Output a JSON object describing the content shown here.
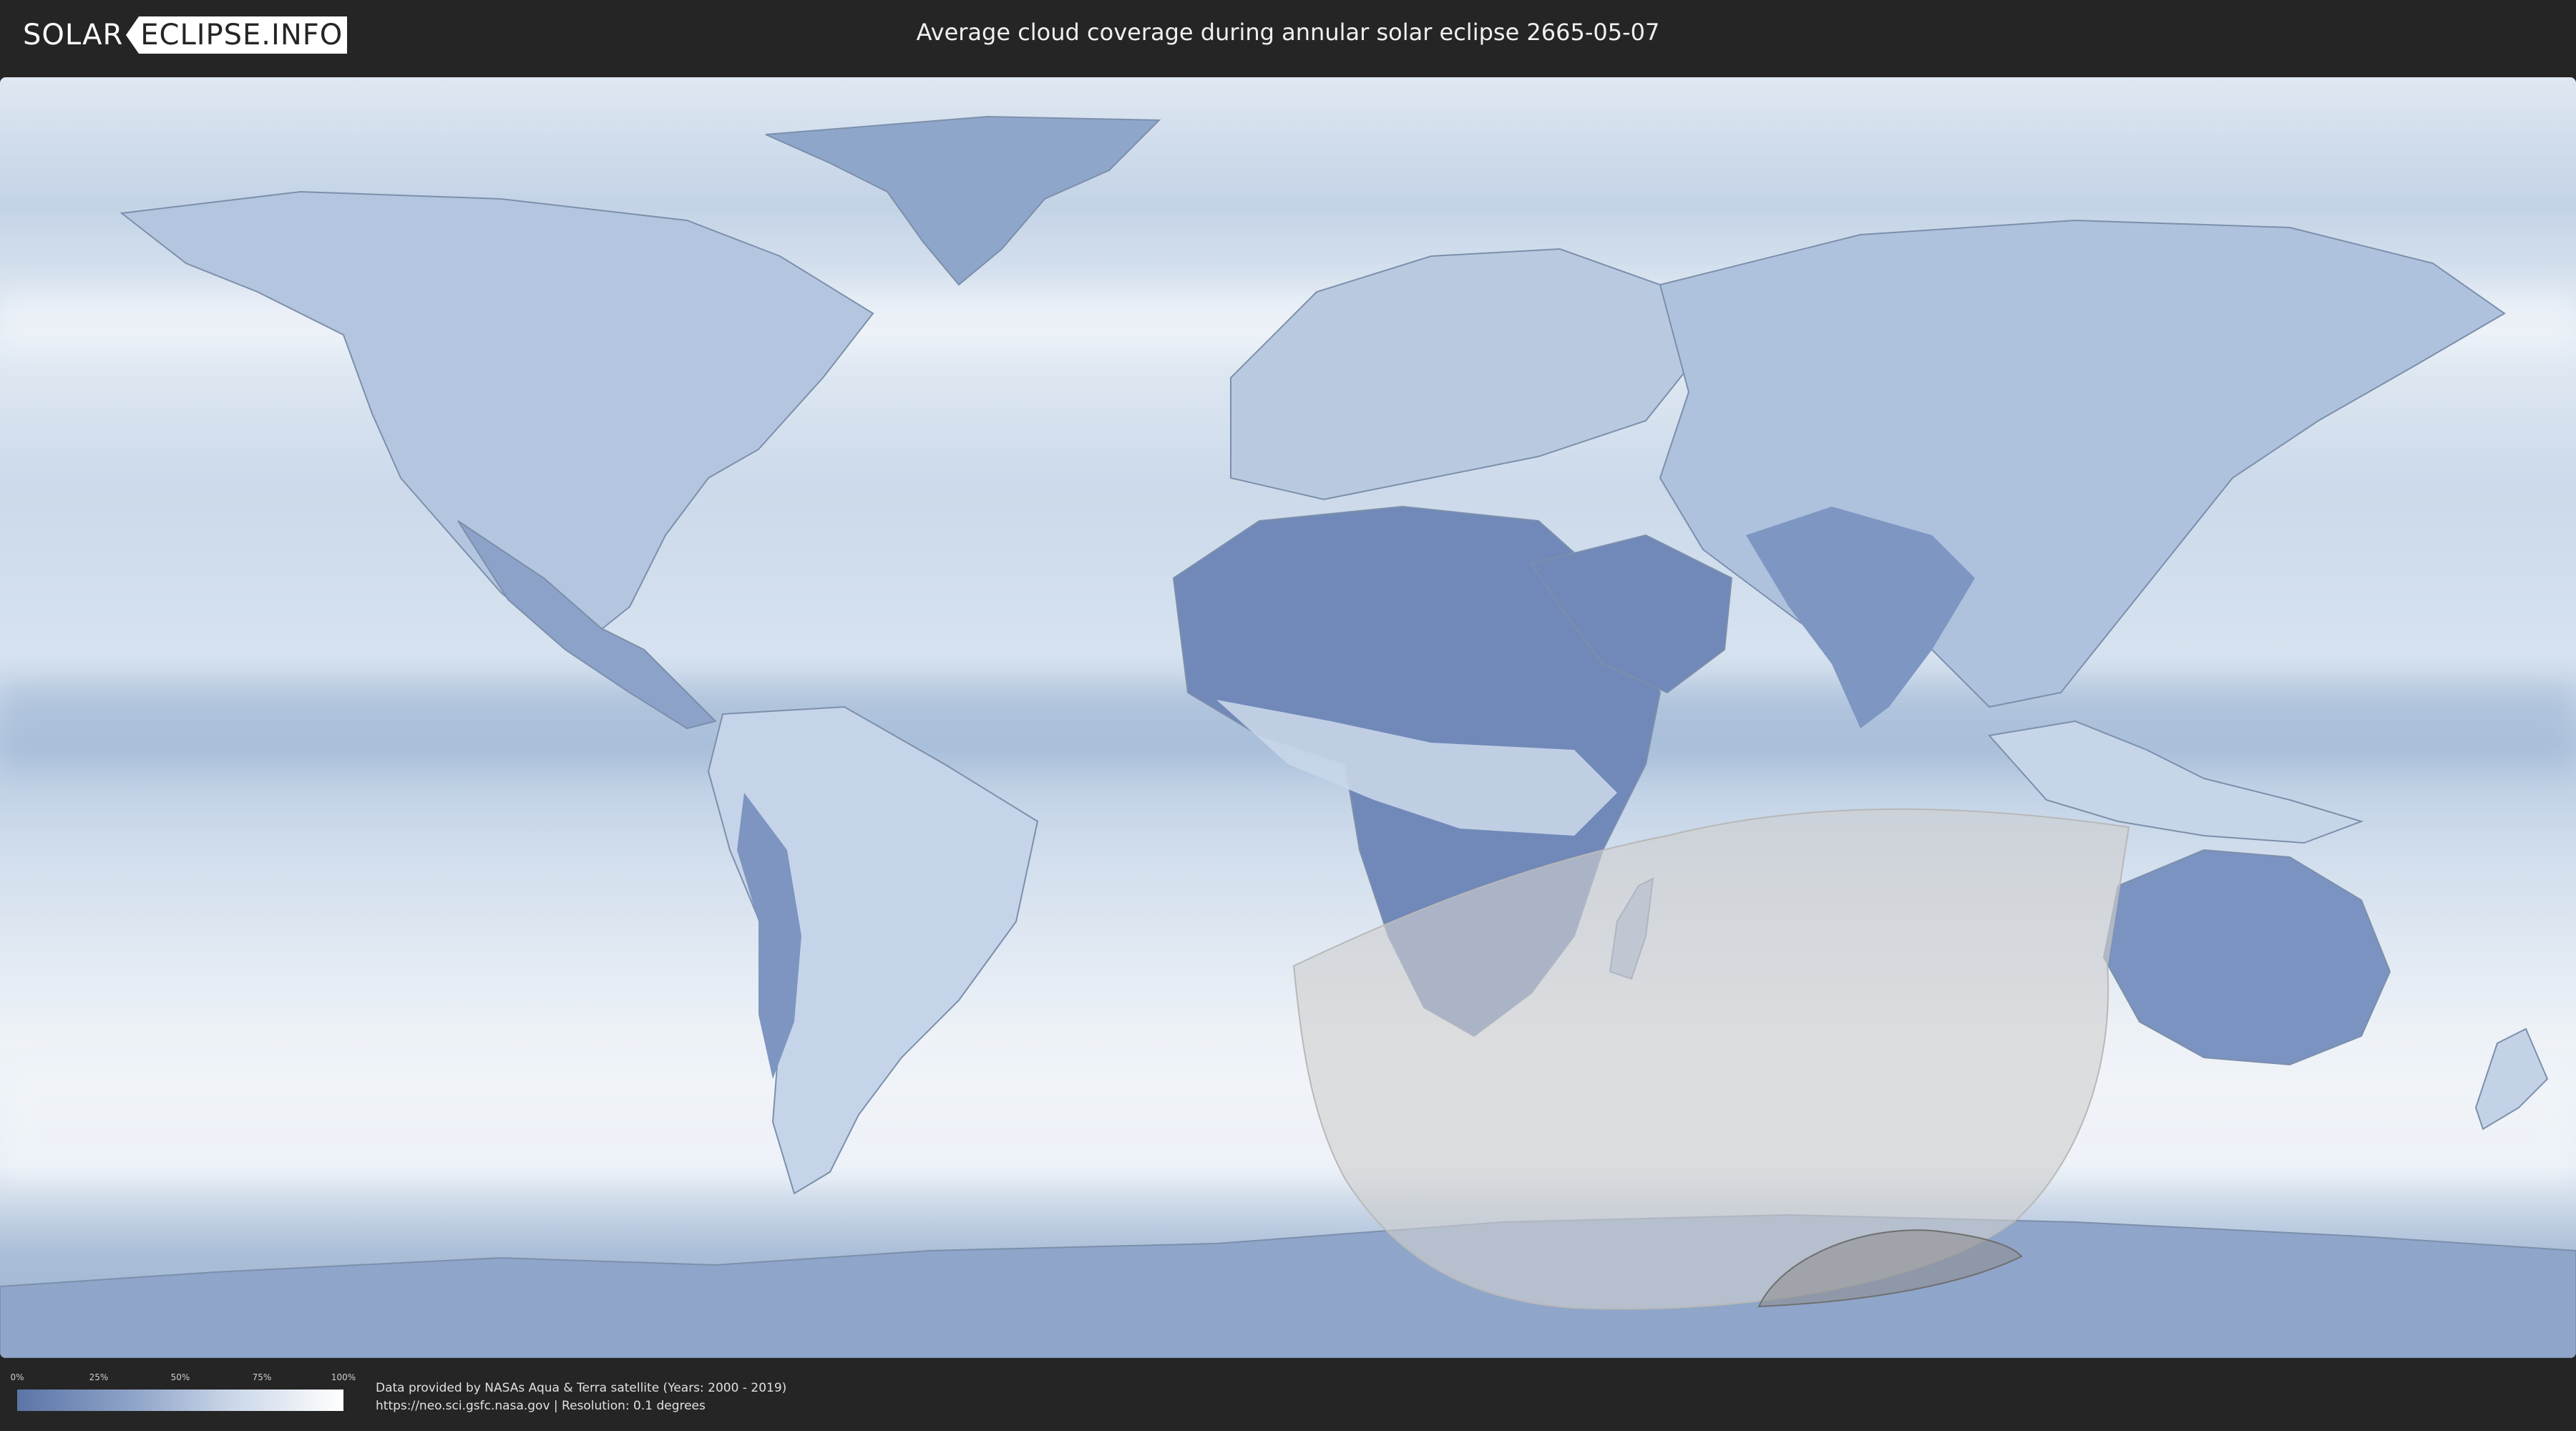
{
  "header": {
    "logo_part1": "SOLAR",
    "logo_part2": "ECLIPSE.INFO",
    "title": "Average cloud coverage during annular solar eclipse 2665-05-07"
  },
  "legend": {
    "ticks": [
      "0%",
      "25%",
      "50%",
      "75%",
      "100%"
    ],
    "colors": {
      "low": "#5b75a6",
      "high": "#ffffff"
    }
  },
  "credits": {
    "line1": "Data provided by NASAs Aqua & Terra satellite (Years: 2000 - 2019)",
    "line2": "https://neo.sci.gsfc.nasa.gov | Resolution: 0.1 degrees"
  },
  "map": {
    "projection": "equirectangular world map",
    "eclipse_region": "southern Indian Ocean to Antarctica",
    "colors": {
      "land_clear": "#7890bd",
      "cloud": "#f2f5f9",
      "eclipse_zone": "#d0d0d0",
      "path_core": "#8c8c8c"
    }
  }
}
